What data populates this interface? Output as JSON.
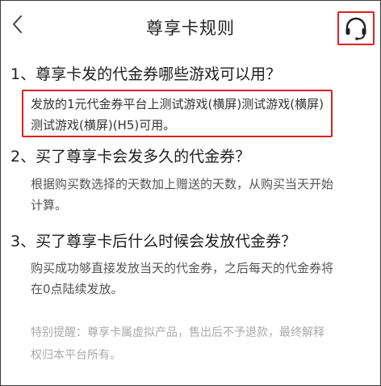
{
  "header": {
    "title": "尊享卡规则",
    "back_icon": "chevron-left-icon",
    "service_icon": "headset-icon"
  },
  "faq": [
    {
      "question": "1、尊享卡发的代金券哪些游戏可以用？",
      "answer": "发放的1元代金券平台上测试游戏(横屏)测试游戏(横屏)测试游戏(横屏)(H5)可用。"
    },
    {
      "question": "2、买了尊享卡会发多久的代金券？",
      "answer": "根据购买数选择的天数加上赠送的天数，从购买当天开始计算。"
    },
    {
      "question": "3、买了尊享卡后什么时候会发放代金券？",
      "answer": "购买成功够直接发放当天的代金券，之后每天的代金券将在0点陆续发放。"
    }
  ],
  "note": "特别提醒：尊享卡属虚拟产品，售出后不予退款，最终解释权归本平台所有。",
  "colors": {
    "highlight": "#e02020",
    "question": "#1f1f1f",
    "answer": "#555555",
    "note": "#aaaaaa"
  }
}
